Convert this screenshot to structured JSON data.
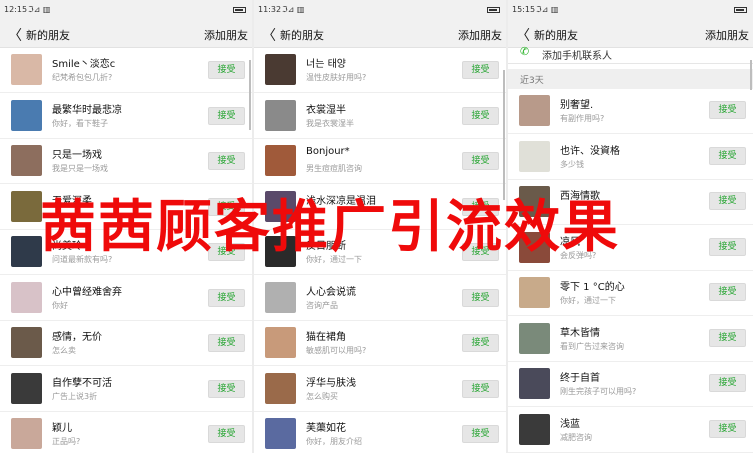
{
  "overlay": {
    "text": "茜茜顾客推广引流效果",
    "color": "#ef0a0a"
  },
  "accent_color": "#27a532",
  "panels": [
    {
      "status": {
        "time": "12:15",
        "signal": "ℑ⊿ ▥",
        "right": "⊕ ▭"
      },
      "nav": {
        "back": "〈",
        "title": "新的朋友",
        "action": "添加朋友"
      },
      "rows": [
        {
          "name": "Smile丶淡恋c",
          "message": "纪梵希包包几折?",
          "button": "接受",
          "avatar_color": "#d9b8a6"
        },
        {
          "name": "最繁华时最悲凉",
          "message": "你好，看下鞋子",
          "button": "接受",
          "avatar_color": "#4a7bb0"
        },
        {
          "name": "只是一场戏",
          "message": "我是只是一场戏",
          "button": "接受",
          "avatar_color": "#8d6e5e"
        },
        {
          "name": "无爱深柔",
          "message": "",
          "button": "接受",
          "avatar_color": "#7a6a3c"
        },
        {
          "name": "尚美玲",
          "message": "问道最新款有吗?",
          "button": "接受",
          "avatar_color": "#2f3a4a"
        },
        {
          "name": "心中曾经难舍弃",
          "message": "你好",
          "button": "接受",
          "avatar_color": "#d8c2c8"
        },
        {
          "name": "感情，无价",
          "message": "怎么卖",
          "button": "接受",
          "avatar_color": "#6b5a4a"
        },
        {
          "name": "自作孽不可活",
          "message": "广告上说3折",
          "button": "接受",
          "avatar_color": "#3a3a3a"
        },
        {
          "name": "颖儿",
          "message": "正品吗?",
          "button": "接受",
          "avatar_color": "#c9a89a"
        }
      ]
    },
    {
      "status": {
        "time": "11:32",
        "signal": "ℑ⊿ ▥",
        "right": "⊕ ▭"
      },
      "nav": {
        "back": "〈",
        "title": "新的朋友",
        "action": "添加朋友"
      },
      "rows": [
        {
          "name": "너는 태양",
          "message": "温性皮肤好用吗?",
          "button": "接受",
          "avatar_color": "#4a3a32"
        },
        {
          "name": "衣裳湿半",
          "message": "我是衣裳湿半",
          "button": "接受",
          "avatar_color": "#8a8a8a"
        },
        {
          "name": "Bonjour*",
          "message": "男生痘痘肌咨询",
          "button": "接受",
          "avatar_color": "#a05a3a"
        },
        {
          "name": "浅水深凉是温泪",
          "message": "",
          "button": "接受",
          "avatar_color": "#5a4a6a"
        },
        {
          "name": "反目朋断",
          "message": "你好，通过一下",
          "button": "接受",
          "avatar_color": "#2a2a2a"
        },
        {
          "name": "人心会说谎",
          "message": "咨询产品",
          "button": "接受",
          "avatar_color": "#b0b0b0"
        },
        {
          "name": "猫在裙角",
          "message": "敏感肌可以用吗?",
          "button": "接受",
          "avatar_color": "#c89a7a"
        },
        {
          "name": "浮华与肤浅",
          "message": "怎么购买",
          "button": "接受",
          "avatar_color": "#9a6a4a"
        },
        {
          "name": "芙蕖如花",
          "message": "你好，朋友介绍",
          "button": "接受",
          "avatar_color": "#5a6aa0"
        }
      ]
    },
    {
      "status": {
        "time": "15:15",
        "signal": "ℑ⊿ ▥",
        "right": "⊕ ▭"
      },
      "nav": {
        "back": "〈",
        "title": "新的朋友",
        "action": "添加朋友"
      },
      "contact": {
        "label": "添加手机联系人"
      },
      "section": "近3天",
      "rows": [
        {
          "name": "别奢望.",
          "message": "有副作用吗?",
          "button": "接受",
          "avatar_color": "#b89a8a"
        },
        {
          "name": "也许、没資格",
          "message": "多少钱",
          "button": "接受",
          "avatar_color": "#e0e0d8"
        },
        {
          "name": "西海情歌",
          "message": "",
          "button": "接受",
          "avatar_color": "#6a5a4a"
        },
        {
          "name": "凉风",
          "message": "会反弹吗?",
          "button": "接受",
          "avatar_color": "#8a4a3a"
        },
        {
          "name": "零下 1 °C的心",
          "message": "你好，通过一下",
          "button": "接受",
          "avatar_color": "#c8aa8a"
        },
        {
          "name": "草木皆情",
          "message": "看到广告过来咨询",
          "button": "接受",
          "avatar_color": "#7a8a7a"
        },
        {
          "name": "终于自首",
          "message": "刚生完孩子可以用吗?",
          "button": "接受",
          "avatar_color": "#4a4a5a"
        },
        {
          "name": "浅蓝",
          "message": "减肥咨询",
          "button": "接受",
          "avatar_color": "#3a3a3a"
        }
      ]
    }
  ]
}
